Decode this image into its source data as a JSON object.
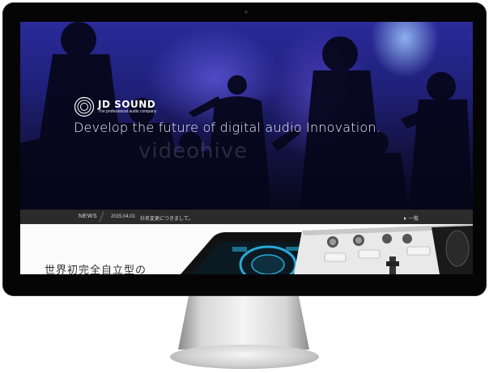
{
  "hero": {
    "brand": "JD SOUND",
    "brand_tagline": "The professional audio company",
    "headline": "Develop the future of digital audio Innovation.",
    "watermark": "videohive"
  },
  "news": {
    "label": "NEWS",
    "items": [
      {
        "date": "2015.04.01",
        "text": "社名変更につきまして。"
      }
    ],
    "more_label": "一覧"
  },
  "content": {
    "heading": "世界初完全自立型の"
  },
  "colors": {
    "hero_blue": "#20207a",
    "newsbar": "#2b2b2b",
    "bezel": "#050505",
    "device_accent": "#2aa8d8"
  }
}
